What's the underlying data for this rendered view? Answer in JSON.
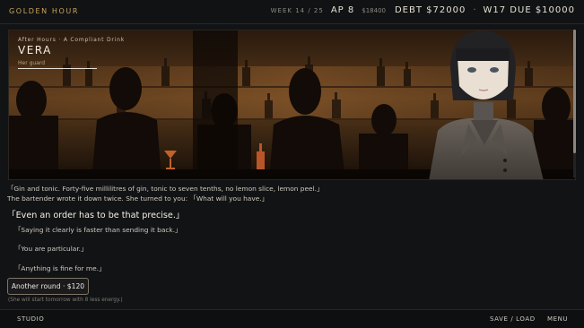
{
  "topbar": {
    "title": "GOLDEN HOUR",
    "week": "WEEK 14 / 25",
    "ap": "AP 8",
    "money": "$18400",
    "debt": "DEBT $72000",
    "separator": "·",
    "due": "W17 DUE $10000"
  },
  "scene": {
    "chapter": "After Hours · A Compliant Drink",
    "character_name": "VERA",
    "character_role": "Her guard"
  },
  "dialogue": {
    "line1": "「Gin and tonic. Forty-five millilitres of gin, tonic to seven tenths, no lemon slice, lemon peel.」",
    "line2": "The bartender wrote it down twice. She turned to you: 「What will you have.」",
    "emphasis": "「Even an order has to be that precise.」"
  },
  "choices": [
    "「Saying it clearly is faster than sending it back.」",
    "「You are particular.」",
    "「Anything is fine for me.」"
  ],
  "action": {
    "label": "Another round · $120",
    "note": "(She will start tomorrow with 8 less energy.)"
  },
  "bottombar": {
    "studio": "STUDIO",
    "save_load": "SAVE / LOAD",
    "menu": "MENU"
  },
  "colors": {
    "accent_gold": "#c9a45a",
    "background": "#121315",
    "text": "#d8d4cc"
  }
}
